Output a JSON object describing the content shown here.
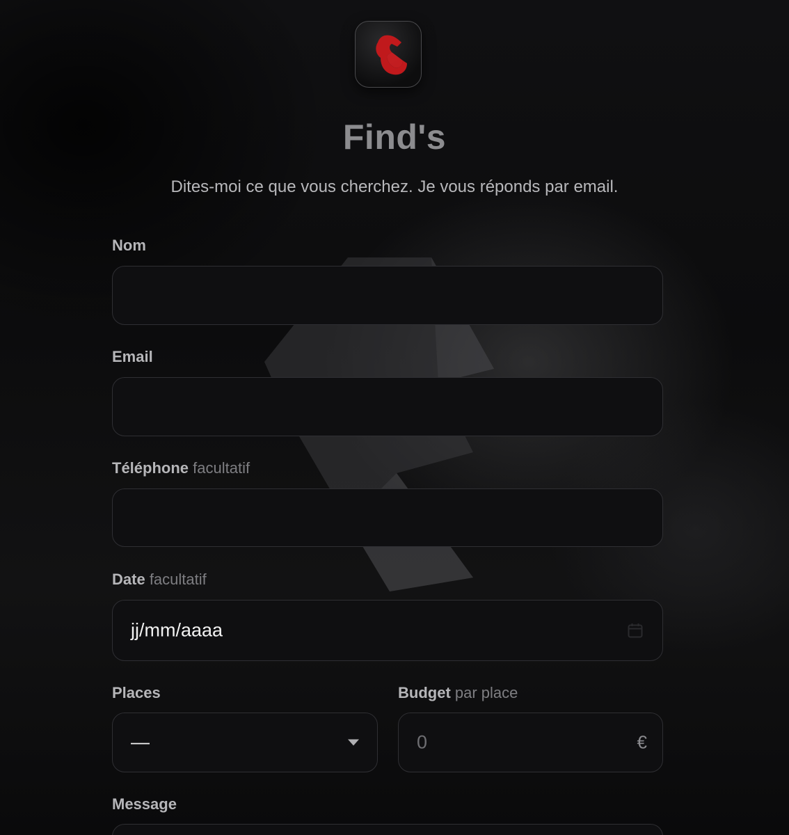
{
  "header": {
    "logo_icon": "finds-red-f-icon",
    "title": "Find's",
    "subtitle": "Dites-moi ce que vous cherchez. Je vous réponds par email."
  },
  "form": {
    "name": {
      "label": "Nom",
      "value": ""
    },
    "email": {
      "label": "Email",
      "value": ""
    },
    "phone": {
      "label": "Téléphone",
      "optional": "facultatif",
      "value": ""
    },
    "date": {
      "label": "Date",
      "optional": "facultatif",
      "placeholder": "jj/mm/aaaa",
      "icon": "calendar-icon"
    },
    "places": {
      "label": "Places",
      "selected": "—",
      "icon": "dropdown-caret-icon"
    },
    "budget": {
      "label": "Budget",
      "optional": "par place",
      "placeholder": "0",
      "currency": "€"
    },
    "message": {
      "label": "Message"
    }
  },
  "colors": {
    "background": "#0b0b0c",
    "field_bg": "#0f0f11",
    "field_border": "#2f2f33",
    "brand_red": "#c0191c",
    "label": "#b6b6b9",
    "title": "#8c8c8f"
  }
}
